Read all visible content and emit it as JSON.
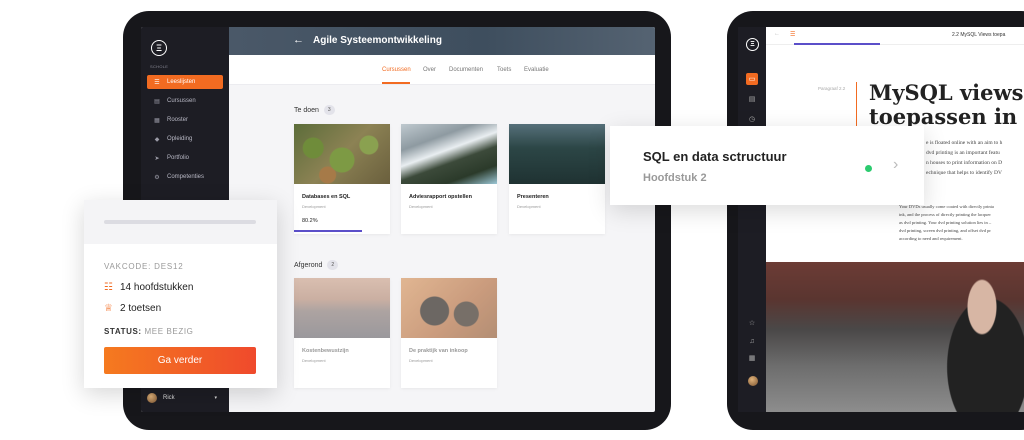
{
  "tablet1": {
    "sidebar": {
      "school_label": "SCHOLE",
      "items": [
        {
          "label": "Leeslijsten",
          "icon": "list-icon",
          "active": true
        },
        {
          "label": "Cursussen",
          "icon": "book-icon"
        },
        {
          "label": "Rooster",
          "icon": "calendar-icon"
        },
        {
          "label": "Opleiding",
          "icon": "graduation-cap-icon"
        },
        {
          "label": "Portfolio",
          "icon": "send-icon"
        },
        {
          "label": "Competenties",
          "icon": "settings-icon"
        }
      ],
      "user_name": "Rick"
    },
    "header": {
      "back": "←",
      "title": "Agile Systeemontwikkeling"
    },
    "tabs": [
      "Cursussen",
      "Over",
      "Documenten",
      "Toets",
      "Evaluatie"
    ],
    "todo": {
      "label": "Te doen",
      "count": "3",
      "cards": [
        {
          "title": "Databases en SQL",
          "subtitle": "Development",
          "progress_text": "80.2%",
          "progress": 0.802
        },
        {
          "title": "Adviesrapport opstellen",
          "subtitle": "Development"
        },
        {
          "title": "Presenteren",
          "subtitle": "Development"
        }
      ]
    },
    "done": {
      "label": "Afgerond",
      "count": "2",
      "cards": [
        {
          "title": "Kostenbewustzijn",
          "subtitle": "Development"
        },
        {
          "title": "De praktijk van inkoop",
          "subtitle": "Development"
        }
      ]
    }
  },
  "course_card": {
    "code": "VAKCODE: DES12",
    "chapters": "14 hoofdstukken",
    "tests": "2 toetsen",
    "status_label": "STATUS:",
    "status_value": "MEE BEZIG",
    "button": "Ga verder"
  },
  "chapter_card": {
    "title": "SQL en data sctructuur",
    "subtitle": "Hoofdstuk 2"
  },
  "tablet2": {
    "top_title": "2.2 MySQL Views toepa",
    "paragraph_label": "Paragraaf 2.2",
    "heading_line1": "MySQL views",
    "heading_line2": "toepassen in",
    "text_lines": [
      "e is floated online with an aim to h",
      "dvd printing is an important featu",
      "n houses to print information on D",
      "echnique that helps to identify DV"
    ],
    "body_lines": [
      "Your DVDs usually come coated with directly printa",
      "ink, and the process of directly printing the lacquer",
      "as dvd printing. Your dvd printing solution lies in –",
      "dvd printing, screen dvd printing, and offset dvd pr",
      "according to need and requirement."
    ]
  },
  "colors": {
    "accent": "#f26b21",
    "progress": "#5b4fc9",
    "online": "#2ccb6f",
    "sidebar": "#1d1d24"
  }
}
